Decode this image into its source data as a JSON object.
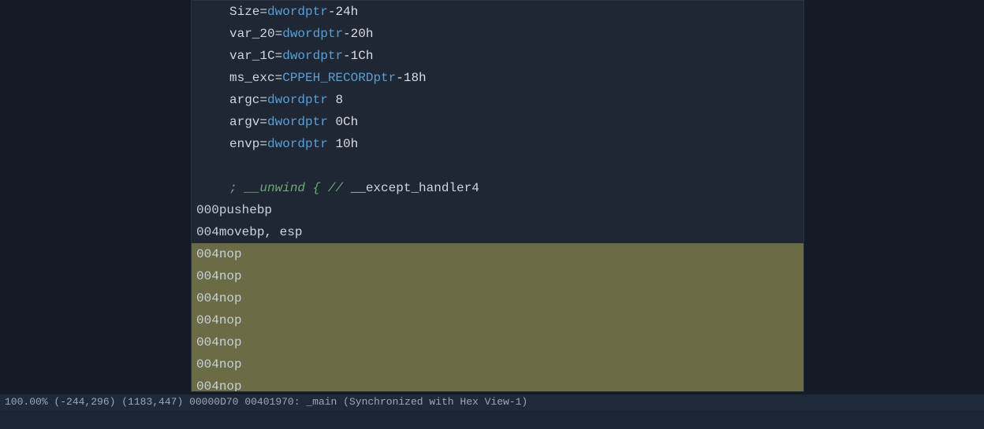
{
  "colors": {
    "bg": "#141b26",
    "panel": "#1e2733",
    "selection": "#6b6b45",
    "type": "#5aa0d6",
    "comment": "#6fa87a",
    "text": "#cdd6e0",
    "status": "#9aa7b5"
  },
  "declarations": [
    {
      "name": "Size",
      "eq": "=",
      "type": "dword",
      "ptr": "ptr",
      "offset": "-24h"
    },
    {
      "name": "var_20",
      "eq": "=",
      "type": "dword",
      "ptr": "ptr",
      "offset": "-20h"
    },
    {
      "name": "var_1C",
      "eq": "=",
      "type": "dword",
      "ptr": "ptr",
      "offset": "-1Ch"
    },
    {
      "name": "ms_exc",
      "eq": "=",
      "type": "CPPEH_RECORD",
      "ptr": "ptr",
      "offset": "-18h"
    },
    {
      "name": "argc",
      "eq": "=",
      "type": "dword",
      "ptr": "ptr",
      "offset": " 8"
    },
    {
      "name": "argv",
      "eq": "=",
      "type": "dword",
      "ptr": "ptr",
      "offset": " 0Ch"
    },
    {
      "name": "envp",
      "eq": "=",
      "type": "dword",
      "ptr": "ptr",
      "offset": " 10h"
    }
  ],
  "comment_line": {
    "prefix": "; __unwind { // ",
    "handler": "__except_handler4"
  },
  "instructions": [
    {
      "offset": "000",
      "mnemonic": "push",
      "operands": "ebp",
      "selected": false
    },
    {
      "offset": "004",
      "mnemonic": "mov",
      "operands": "ebp, esp",
      "selected": false
    },
    {
      "offset": "004",
      "mnemonic": "nop",
      "operands": "",
      "selected": true
    },
    {
      "offset": "004",
      "mnemonic": "nop",
      "operands": "",
      "selected": true
    },
    {
      "offset": "004",
      "mnemonic": "nop",
      "operands": "",
      "selected": true
    },
    {
      "offset": "004",
      "mnemonic": "nop",
      "operands": "",
      "selected": true
    },
    {
      "offset": "004",
      "mnemonic": "nop",
      "operands": "",
      "selected": true
    },
    {
      "offset": "004",
      "mnemonic": "nop",
      "operands": "",
      "selected": true
    },
    {
      "offset": "004",
      "mnemonic": "nop",
      "operands": "",
      "selected": true
    }
  ],
  "status": {
    "zoom": "100.00%",
    "coord1": "(-244,296)",
    "coord2": "(1183,447)",
    "fileoff": "00000D70",
    "addr": "00401970:",
    "symbol": "_main",
    "sync": "(Synchronized with Hex View-1)"
  }
}
